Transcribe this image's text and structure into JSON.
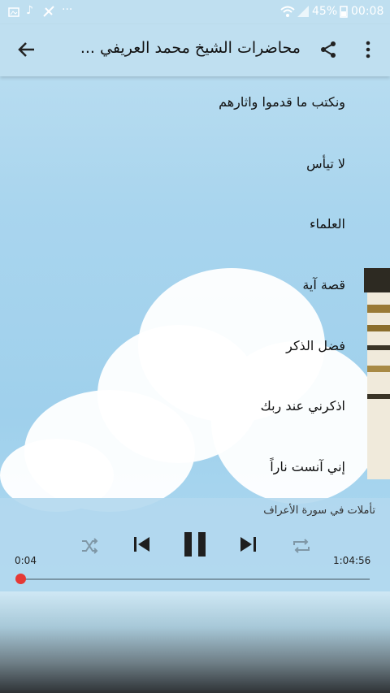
{
  "status_bar": {
    "battery": "45%",
    "time": "00:08",
    "dots": "···"
  },
  "app_bar": {
    "title": "محاضرات الشيخ محمد العريفي ...",
    "icons": [
      "back-arrow-icon",
      "share-icon",
      "overflow-menu-icon"
    ]
  },
  "list": {
    "items": [
      {
        "label": "ونكتب ما قدموا واثارهم"
      },
      {
        "label": "لا تيأس"
      },
      {
        "label": "العلماء"
      },
      {
        "label": "قصة آية"
      },
      {
        "label": "فضل الذكر"
      },
      {
        "label": "اذكرني عند ربك"
      },
      {
        "label": "إني آنست ناراً"
      }
    ]
  },
  "player": {
    "track_title": "تأملات في سورة الأعراف",
    "current_time": "0:04",
    "total_time": "1:04:56",
    "progress_fraction": 0.001,
    "accent_color": "#e53935",
    "icons": [
      "shuffle-icon",
      "previous-icon",
      "pause-icon",
      "next-icon",
      "repeat-icon"
    ]
  },
  "colors": {
    "sky": "#a9d5ee",
    "app_bar": "#bfdff0",
    "text": "#111111"
  }
}
